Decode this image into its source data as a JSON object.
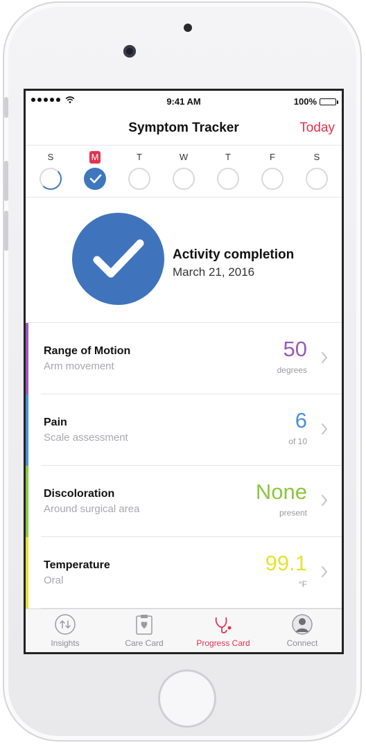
{
  "status_bar": {
    "time": "9:41 AM",
    "battery": "100%"
  },
  "nav": {
    "title": "Symptom Tracker",
    "today_button": "Today"
  },
  "week": {
    "days": [
      {
        "letter": "S",
        "state": "partial",
        "today": false
      },
      {
        "letter": "M",
        "state": "done",
        "today": true
      },
      {
        "letter": "T",
        "state": "empty",
        "today": false
      },
      {
        "letter": "W",
        "state": "empty",
        "today": false
      },
      {
        "letter": "T",
        "state": "empty",
        "today": false
      },
      {
        "letter": "F",
        "state": "empty",
        "today": false
      },
      {
        "letter": "S",
        "state": "empty",
        "today": false
      }
    ]
  },
  "summary": {
    "title": "Activity completion",
    "date": "March 21, 2016",
    "icon": "checkmark-icon"
  },
  "rows": [
    {
      "title": "Range of Motion",
      "subtitle": "Arm movement",
      "value": "50",
      "unit": "degrees",
      "color": "#9b59b6"
    },
    {
      "title": "Pain",
      "subtitle": "Scale assessment",
      "value": "6",
      "unit": "of 10",
      "color": "#4a90d9"
    },
    {
      "title": "Discoloration",
      "subtitle": "Around surgical area",
      "value": "None",
      "unit": "present",
      "color": "#8cc63f"
    },
    {
      "title": "Temperature",
      "subtitle": "Oral",
      "value": "99.1",
      "unit": "°F",
      "color": "#e6e234"
    }
  ],
  "tabs": [
    {
      "label": "Insights",
      "icon": "insights-icon",
      "active": false
    },
    {
      "label": "Care Card",
      "icon": "care-card-icon",
      "active": false
    },
    {
      "label": "Progress Card",
      "icon": "stethoscope-icon",
      "active": true
    },
    {
      "label": "Connect",
      "icon": "person-icon",
      "active": false
    }
  ],
  "colors": {
    "accent": "#e4314f",
    "primary_blue": "#3f74bd"
  }
}
